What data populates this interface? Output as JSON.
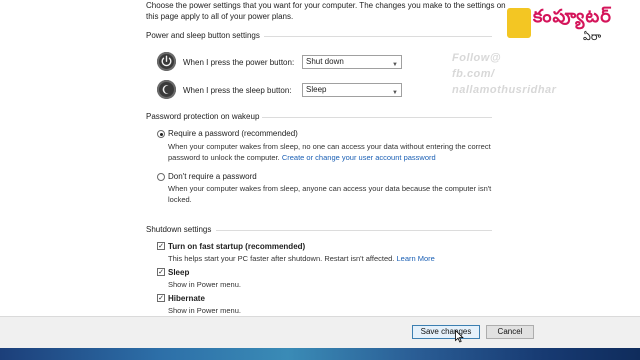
{
  "intro_text": "Choose the power settings that you want for your computer. The changes you make to the settings on this page apply to all of your power plans.",
  "power_sleep": {
    "title": "Power and sleep button settings",
    "power_button_label": "When I press the power button:",
    "power_button_value": "Shut down",
    "sleep_button_label": "When I press the sleep button:",
    "sleep_button_value": "Sleep"
  },
  "password": {
    "title": "Password protection on wakeup",
    "require_label": "Require a password (recommended)",
    "require_desc_1": "When your computer wakes from sleep, no one can access your data without entering the correct",
    "require_desc_2": "password to unlock the computer.",
    "require_link": "Create or change your user account password",
    "dont_label": "Don't require a password",
    "dont_desc_1": "When your computer wakes from sleep, anyone can access your data because the computer isn't",
    "dont_desc_2": "locked."
  },
  "shutdown": {
    "title": "Shutdown settings",
    "fast_startup_label": "Turn on fast startup (recommended)",
    "fast_startup_desc": "This helps start your PC faster after shutdown. Restart isn't affected.",
    "learn_more": "Learn More",
    "sleep_label": "Sleep",
    "sleep_desc": "Show in Power menu.",
    "hibernate_label": "Hibernate",
    "hibernate_desc": "Show in Power menu."
  },
  "buttons": {
    "save": "Save changes",
    "cancel": "Cancel"
  },
  "watermark": {
    "line1": "Follow@",
    "line2": "fb.com/",
    "line3": "nallamothusridhar"
  },
  "logo": {
    "text": "కంప్యూటర్",
    "sub": "ఏరా"
  },
  "icons": {
    "power": "power-icon",
    "sleep": "moon-icon",
    "checkmark": "check-icon",
    "cursor": "mouse-pointer-icon"
  }
}
